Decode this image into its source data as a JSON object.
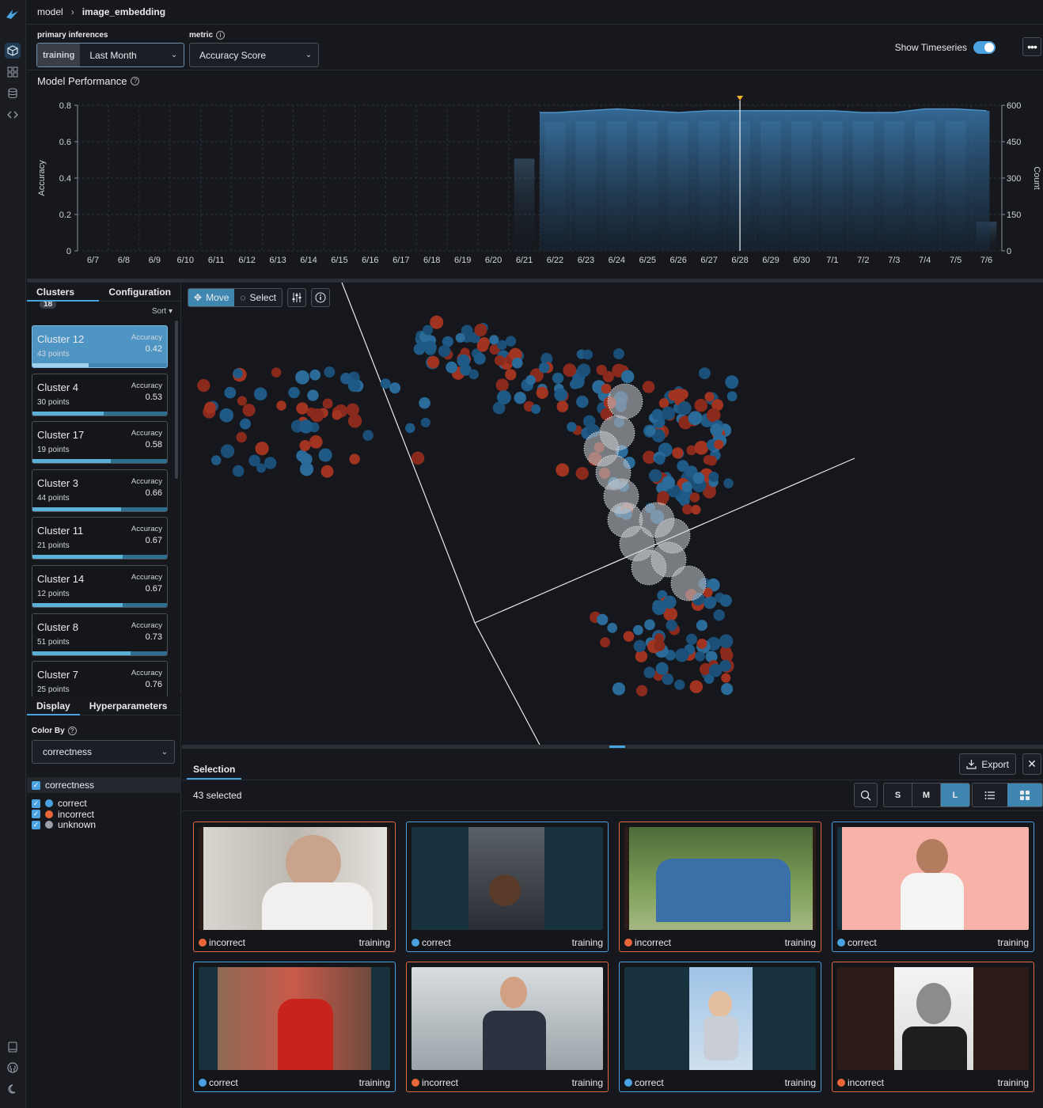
{
  "breadcrumb": {
    "root": "model",
    "current": "image_embedding"
  },
  "controls": {
    "primary_label": "primary inferences",
    "primary_tag": "training",
    "primary_value": "Last Month",
    "metric_label": "metric",
    "metric_value": "Accuracy Score",
    "show_timeseries_label": "Show Timeseries",
    "show_timeseries_on": true
  },
  "performance": {
    "title": "Model Performance"
  },
  "chart_data": {
    "type": "area",
    "ylabel": "Accuracy",
    "y2label": "Count",
    "ylim": [
      0,
      0.8
    ],
    "y2lim": [
      0,
      600
    ],
    "yticks": [
      "0.8",
      "0.6",
      "0.4",
      "0.2",
      "0"
    ],
    "y2ticks": [
      "600",
      "450",
      "300",
      "150",
      "0"
    ],
    "categories": [
      "6/7",
      "6/8",
      "6/9",
      "6/10",
      "6/11",
      "6/12",
      "6/13",
      "6/14",
      "6/15",
      "6/16",
      "6/17",
      "6/18",
      "6/19",
      "6/20",
      "6/21",
      "6/22",
      "6/23",
      "6/24",
      "6/25",
      "6/26",
      "6/27",
      "6/28",
      "6/29",
      "6/30",
      "7/1",
      "7/2",
      "7/3",
      "7/4",
      "7/5",
      "7/6"
    ],
    "series": [
      {
        "values": [
          null,
          null,
          null,
          null,
          null,
          null,
          null,
          null,
          null,
          null,
          null,
          null,
          null,
          null,
          null,
          0.76,
          0.77,
          0.78,
          0.77,
          0.76,
          0.77,
          0.77,
          0.77,
          0.77,
          0.77,
          0.76,
          0.76,
          0.78,
          0.78,
          0.77
        ]
      },
      {
        "values": [
          0,
          0,
          0,
          0,
          0,
          0,
          0,
          0,
          0,
          0,
          0,
          0,
          0,
          0,
          380,
          530,
          535,
          535,
          535,
          535,
          535,
          535,
          535,
          535,
          535,
          535,
          535,
          535,
          535,
          120
        ]
      }
    ],
    "marker_category": "6/28",
    "grid": true
  },
  "clusters": {
    "tab_label": "Clusters",
    "count": "18",
    "config_tab": "Configuration",
    "sort_label": "Sort",
    "accuracy_label": "Accuracy",
    "items": [
      {
        "name": "Cluster 12",
        "points": "43 points",
        "accuracy": "0.42",
        "selected": true
      },
      {
        "name": "Cluster 4",
        "points": "30 points",
        "accuracy": "0.53"
      },
      {
        "name": "Cluster 17",
        "points": "19 points",
        "accuracy": "0.58"
      },
      {
        "name": "Cluster 3",
        "points": "44 points",
        "accuracy": "0.66"
      },
      {
        "name": "Cluster 11",
        "points": "21 points",
        "accuracy": "0.67"
      },
      {
        "name": "Cluster 14",
        "points": "12 points",
        "accuracy": "0.67"
      },
      {
        "name": "Cluster 8",
        "points": "51 points",
        "accuracy": "0.73"
      },
      {
        "name": "Cluster 7",
        "points": "25 points",
        "accuracy": "0.76"
      }
    ]
  },
  "display": {
    "tab_display": "Display",
    "tab_hyper": "Hyperparameters",
    "color_by_label": "Color By",
    "color_by_value": "correctness",
    "legend_title": "correctness",
    "legend": [
      {
        "label": "correct",
        "color": "#4aa3e0"
      },
      {
        "label": "incorrect",
        "color": "#e8673a"
      },
      {
        "label": "unknown",
        "color": "#9a9ea6"
      }
    ]
  },
  "view3d": {
    "move_label": "Move",
    "select_label": "Select"
  },
  "selection": {
    "tab_label": "Selection",
    "export_label": "Export",
    "count_text": "43 selected",
    "sizes": [
      "S",
      "M",
      "L"
    ],
    "active_size": "L",
    "colors": {
      "correct": "#4aa3e0",
      "incorrect": "#e8673a"
    },
    "items": [
      {
        "label": "incorrect",
        "source": "training"
      },
      {
        "label": "correct",
        "source": "training"
      },
      {
        "label": "incorrect",
        "source": "training"
      },
      {
        "label": "correct",
        "source": "training"
      },
      {
        "label": "correct",
        "source": "training"
      },
      {
        "label": "incorrect",
        "source": "training"
      },
      {
        "label": "correct",
        "source": "training"
      },
      {
        "label": "incorrect",
        "source": "training"
      }
    ]
  }
}
